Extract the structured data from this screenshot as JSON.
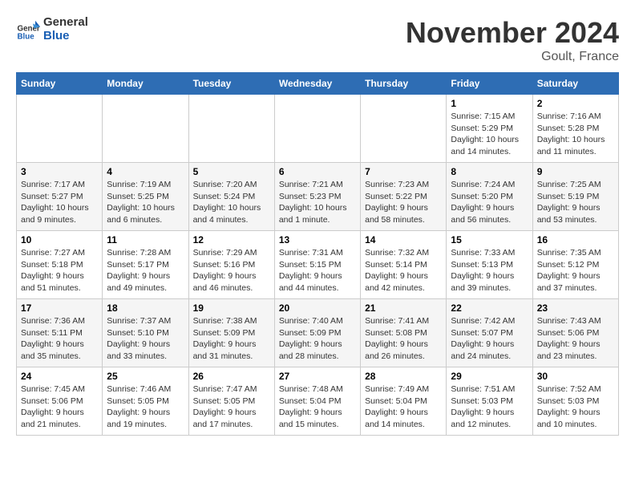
{
  "logo": {
    "line1": "General",
    "line2": "Blue"
  },
  "title": "November 2024",
  "location": "Goult, France",
  "weekdays": [
    "Sunday",
    "Monday",
    "Tuesday",
    "Wednesday",
    "Thursday",
    "Friday",
    "Saturday"
  ],
  "weeks": [
    [
      {
        "day": "",
        "info": ""
      },
      {
        "day": "",
        "info": ""
      },
      {
        "day": "",
        "info": ""
      },
      {
        "day": "",
        "info": ""
      },
      {
        "day": "",
        "info": ""
      },
      {
        "day": "1",
        "info": "Sunrise: 7:15 AM\nSunset: 5:29 PM\nDaylight: 10 hours and 14 minutes."
      },
      {
        "day": "2",
        "info": "Sunrise: 7:16 AM\nSunset: 5:28 PM\nDaylight: 10 hours and 11 minutes."
      }
    ],
    [
      {
        "day": "3",
        "info": "Sunrise: 7:17 AM\nSunset: 5:27 PM\nDaylight: 10 hours and 9 minutes."
      },
      {
        "day": "4",
        "info": "Sunrise: 7:19 AM\nSunset: 5:25 PM\nDaylight: 10 hours and 6 minutes."
      },
      {
        "day": "5",
        "info": "Sunrise: 7:20 AM\nSunset: 5:24 PM\nDaylight: 10 hours and 4 minutes."
      },
      {
        "day": "6",
        "info": "Sunrise: 7:21 AM\nSunset: 5:23 PM\nDaylight: 10 hours and 1 minute."
      },
      {
        "day": "7",
        "info": "Sunrise: 7:23 AM\nSunset: 5:22 PM\nDaylight: 9 hours and 58 minutes."
      },
      {
        "day": "8",
        "info": "Sunrise: 7:24 AM\nSunset: 5:20 PM\nDaylight: 9 hours and 56 minutes."
      },
      {
        "day": "9",
        "info": "Sunrise: 7:25 AM\nSunset: 5:19 PM\nDaylight: 9 hours and 53 minutes."
      }
    ],
    [
      {
        "day": "10",
        "info": "Sunrise: 7:27 AM\nSunset: 5:18 PM\nDaylight: 9 hours and 51 minutes."
      },
      {
        "day": "11",
        "info": "Sunrise: 7:28 AM\nSunset: 5:17 PM\nDaylight: 9 hours and 49 minutes."
      },
      {
        "day": "12",
        "info": "Sunrise: 7:29 AM\nSunset: 5:16 PM\nDaylight: 9 hours and 46 minutes."
      },
      {
        "day": "13",
        "info": "Sunrise: 7:31 AM\nSunset: 5:15 PM\nDaylight: 9 hours and 44 minutes."
      },
      {
        "day": "14",
        "info": "Sunrise: 7:32 AM\nSunset: 5:14 PM\nDaylight: 9 hours and 42 minutes."
      },
      {
        "day": "15",
        "info": "Sunrise: 7:33 AM\nSunset: 5:13 PM\nDaylight: 9 hours and 39 minutes."
      },
      {
        "day": "16",
        "info": "Sunrise: 7:35 AM\nSunset: 5:12 PM\nDaylight: 9 hours and 37 minutes."
      }
    ],
    [
      {
        "day": "17",
        "info": "Sunrise: 7:36 AM\nSunset: 5:11 PM\nDaylight: 9 hours and 35 minutes."
      },
      {
        "day": "18",
        "info": "Sunrise: 7:37 AM\nSunset: 5:10 PM\nDaylight: 9 hours and 33 minutes."
      },
      {
        "day": "19",
        "info": "Sunrise: 7:38 AM\nSunset: 5:09 PM\nDaylight: 9 hours and 31 minutes."
      },
      {
        "day": "20",
        "info": "Sunrise: 7:40 AM\nSunset: 5:09 PM\nDaylight: 9 hours and 28 minutes."
      },
      {
        "day": "21",
        "info": "Sunrise: 7:41 AM\nSunset: 5:08 PM\nDaylight: 9 hours and 26 minutes."
      },
      {
        "day": "22",
        "info": "Sunrise: 7:42 AM\nSunset: 5:07 PM\nDaylight: 9 hours and 24 minutes."
      },
      {
        "day": "23",
        "info": "Sunrise: 7:43 AM\nSunset: 5:06 PM\nDaylight: 9 hours and 23 minutes."
      }
    ],
    [
      {
        "day": "24",
        "info": "Sunrise: 7:45 AM\nSunset: 5:06 PM\nDaylight: 9 hours and 21 minutes."
      },
      {
        "day": "25",
        "info": "Sunrise: 7:46 AM\nSunset: 5:05 PM\nDaylight: 9 hours and 19 minutes."
      },
      {
        "day": "26",
        "info": "Sunrise: 7:47 AM\nSunset: 5:05 PM\nDaylight: 9 hours and 17 minutes."
      },
      {
        "day": "27",
        "info": "Sunrise: 7:48 AM\nSunset: 5:04 PM\nDaylight: 9 hours and 15 minutes."
      },
      {
        "day": "28",
        "info": "Sunrise: 7:49 AM\nSunset: 5:04 PM\nDaylight: 9 hours and 14 minutes."
      },
      {
        "day": "29",
        "info": "Sunrise: 7:51 AM\nSunset: 5:03 PM\nDaylight: 9 hours and 12 minutes."
      },
      {
        "day": "30",
        "info": "Sunrise: 7:52 AM\nSunset: 5:03 PM\nDaylight: 9 hours and 10 minutes."
      }
    ]
  ]
}
